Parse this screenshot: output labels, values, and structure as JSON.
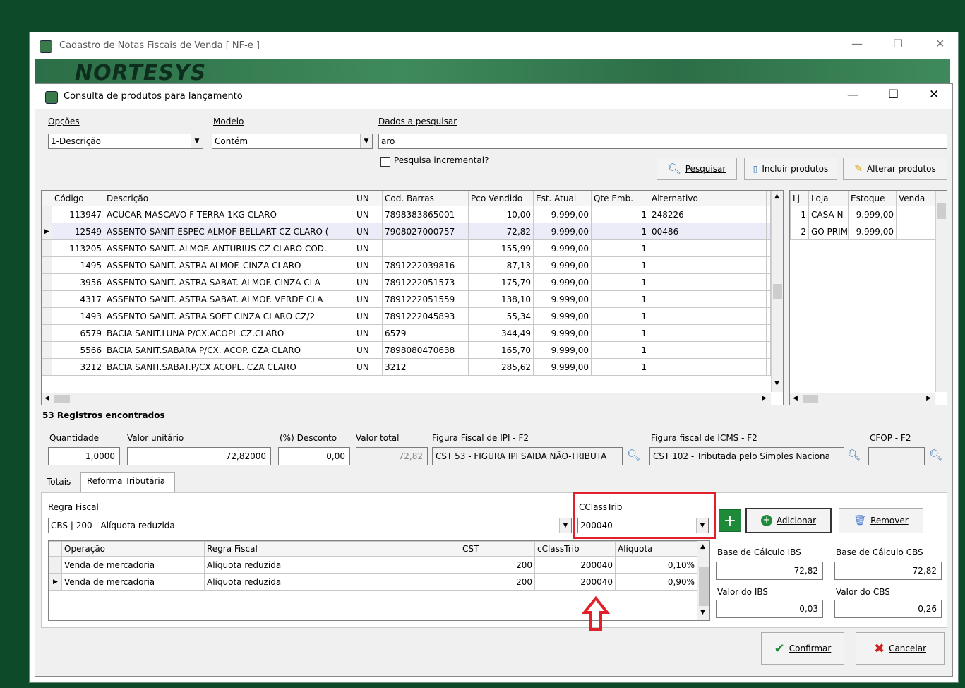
{
  "outer_window": {
    "title": "Cadastro de Notas Fiscais de Venda [ NF-e ]",
    "banner": "NORTESYS"
  },
  "inner_window": {
    "title": "Consulta de produtos para lançamento"
  },
  "search": {
    "options_label": "Opções",
    "options_value": "1-Descrição",
    "model_label": "Modelo",
    "model_value": "Contém",
    "data_label": "Dados a pesquisar",
    "data_value": "aro",
    "incremental_label": "Pesquisa incremental?",
    "search_button": "Pesquisar",
    "include_button": "Incluir produtos",
    "alter_button": "Alterar produtos"
  },
  "products_grid": {
    "columns": [
      "Código",
      "Descrição",
      "UN",
      "Cod. Barras",
      "Pco Vendido",
      "Est. Atual",
      "Qte Emb.",
      "Alternativo"
    ],
    "rows": [
      [
        "113947",
        "ACUCAR MASCAVO F TERRA 1KG CLARO",
        "UN",
        "7898383865001",
        "10,00",
        "9.999,00",
        "1",
        "248226"
      ],
      [
        "12549",
        "ASSENTO SANIT ESPEC ALMOF BELLART CZ CLARO (",
        "UN",
        "7908027000757",
        "72,82",
        "9.999,00",
        "1",
        "00486"
      ],
      [
        "113205",
        "ASSENTO SANIT. ALMOF. ANTURIUS CZ CLARO COD.",
        "UN",
        "",
        "155,99",
        "9.999,00",
        "1",
        ""
      ],
      [
        "1495",
        "ASSENTO SANIT. ASTRA ALMOF. CINZA CLARO",
        "UN",
        "7891222039816",
        "87,13",
        "9.999,00",
        "1",
        ""
      ],
      [
        "3956",
        "ASSENTO SANIT. ASTRA SABAT. ALMOF. CINZA CLA",
        "UN",
        "7891222051573",
        "175,79",
        "9.999,00",
        "1",
        ""
      ],
      [
        "4317",
        "ASSENTO SANIT. ASTRA SABAT. ALMOF. VERDE CLA",
        "UN",
        "7891222051559",
        "138,10",
        "9.999,00",
        "1",
        ""
      ],
      [
        "1493",
        "ASSENTO SANIT. ASTRA SOFT CINZA CLARO CZ/2",
        "UN",
        "7891222045893",
        "55,34",
        "9.999,00",
        "1",
        ""
      ],
      [
        "6579",
        "BACIA SANIT.LUNA P/CX.ACOPL.CZ.CLARO",
        "UN",
        "6579",
        "344,49",
        "9.999,00",
        "1",
        ""
      ],
      [
        "5566",
        "BACIA SANIT.SABARA P/CX. ACOP. CZA CLARO",
        "UN",
        "7898080470638",
        "165,70",
        "9.999,00",
        "1",
        ""
      ],
      [
        "3212",
        "BACIA SANIT.SABAT.P/CX ACOPL. CZA CLARO",
        "UN",
        "3212",
        "285,62",
        "9.999,00",
        "1",
        ""
      ]
    ]
  },
  "stock_grid": {
    "columns": [
      "Lj",
      "Loja",
      "Estoque",
      "Venda"
    ],
    "rows": [
      [
        "1",
        "CASA N",
        "9.999,00",
        ""
      ],
      [
        "2",
        "GO PRIM",
        "9.999,00",
        ""
      ]
    ]
  },
  "records_found": "53 Registros encontrados",
  "entry": {
    "qty_label": "Quantidade",
    "qty_value": "1,0000",
    "unit_label": "Valor unitário",
    "unit_value": "72,82000",
    "disc_label": "(%) Desconto",
    "disc_value": "0,00",
    "total_label": "Valor total",
    "total_value": "72,82",
    "ipi_label": "Figura Fiscal de IPI - F2",
    "ipi_value": "CST 53 - FIGURA IPI SAIDA NÃO-TRIBUTA",
    "icms_label": "Figura fiscal de ICMS - F2",
    "icms_value": "CST 102 - Tributada pelo Simples Naciona",
    "cfop_label": "CFOP - F2",
    "cfop_value": ""
  },
  "tabs": [
    "Totais",
    "Reforma Tributária"
  ],
  "reform": {
    "rule_label": "Regra Fiscal",
    "rule_value": "CBS | 200 - Alíquota reduzida",
    "cclass_label": "CClassTrib",
    "cclass_value": "200040",
    "add_button": "Adicionar",
    "remove_button": "Remover",
    "columns": [
      "Operação",
      "Regra Fiscal",
      "CST",
      "cClassTrib",
      "Alíquota"
    ],
    "rows": [
      [
        "Venda de mercadoria",
        "Alíquota reduzida",
        "200",
        "200040",
        "0,10%"
      ],
      [
        "Venda de mercadoria",
        "Alíquota reduzida",
        "200",
        "200040",
        "0,90%"
      ]
    ],
    "base_ibs_label": "Base de Cálculo IBS",
    "base_ibs_value": "72,82",
    "base_cbs_label": "Base de Cálculo CBS",
    "base_cbs_value": "72,82",
    "val_ibs_label": "Valor do IBS",
    "val_ibs_value": "0,03",
    "val_cbs_label": "Valor do CBS",
    "val_cbs_value": "0,26"
  },
  "footer": {
    "confirm_button": "Confirmar",
    "cancel_button": "Cancelar"
  },
  "colors": {
    "highlight_box": "#e0202a",
    "arrow": "#e0202a",
    "accent_green": "#1f8a3a"
  }
}
